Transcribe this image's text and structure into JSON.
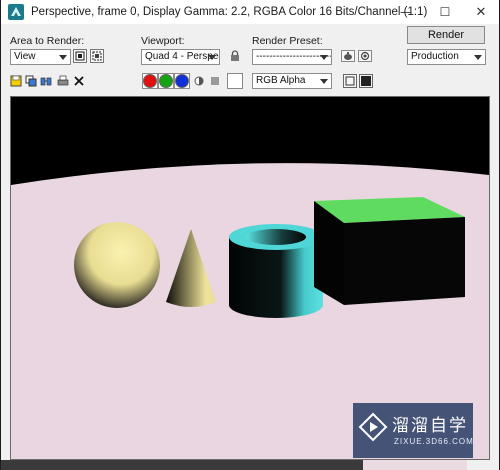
{
  "window": {
    "title": "Perspective, frame 0, Display Gamma: 2.2, RGBA Color 16 Bits/Channel (1:1)",
    "minimize_glyph": "—",
    "maximize_glyph": "☐",
    "close_glyph": "✕"
  },
  "area_to_render": {
    "label": "Area to Render:",
    "value": "View"
  },
  "viewport": {
    "label": "Viewport:",
    "value": "Quad 4 - Perspec"
  },
  "render_preset": {
    "label": "Render Preset:",
    "value": "--------------------------"
  },
  "render_button": {
    "label": "Render"
  },
  "production": {
    "value": "Production"
  },
  "channel": {
    "value": "RGB Alpha"
  },
  "watermark": {
    "title": "溜溜自学",
    "url": "ZIXUE.3D66.COM"
  },
  "colors": {
    "floor": "#e8d5e0",
    "sky": "#000000",
    "sphere": "#efe49c",
    "cone": "#e8dc95",
    "tube": "#4fd9d9",
    "box_top": "#5fdc5f",
    "titlebar": "#ffffff",
    "toolbar": "#f0f0f0"
  },
  "icons": {
    "app": "3dsmax-app-icon",
    "save_image": "save-image-icon",
    "copy_image": "copy-image-icon",
    "clone_frame": "clone-frame-icon",
    "print": "print-icon",
    "clear": "clear-icon",
    "lock": "lock-icon",
    "environment": "environment-icon",
    "teapot_render": "teapot-render-icon"
  }
}
